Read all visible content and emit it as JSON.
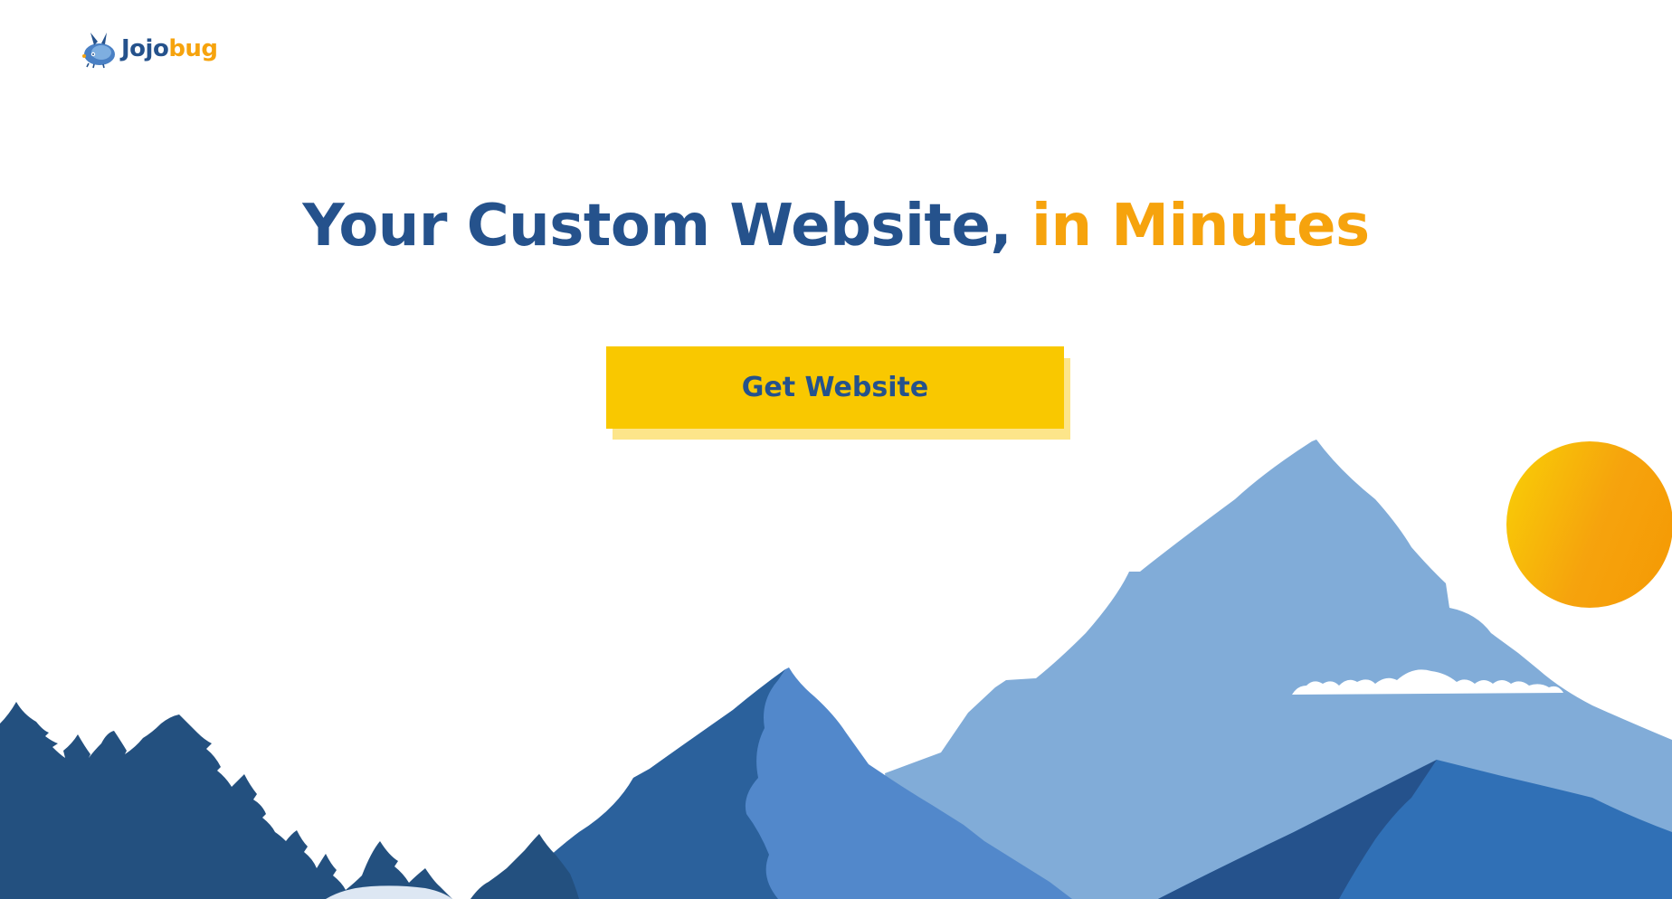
{
  "brand": {
    "name_part1": "Jojo",
    "name_part2": "bug"
  },
  "hero": {
    "title_part1": "Your Custom Website, ",
    "title_part2": "in Minutes"
  },
  "cta": {
    "label": "Get Website"
  },
  "colors": {
    "navy": "#25528c",
    "orange": "#f6a30d",
    "yellow": "#f9c800",
    "yellow_shadow": "#fde58a",
    "mountain_light": "#81acd8",
    "mountain_mid": "#5288cb",
    "mountain_dark": "#2b619c",
    "forest": "#23507f"
  }
}
